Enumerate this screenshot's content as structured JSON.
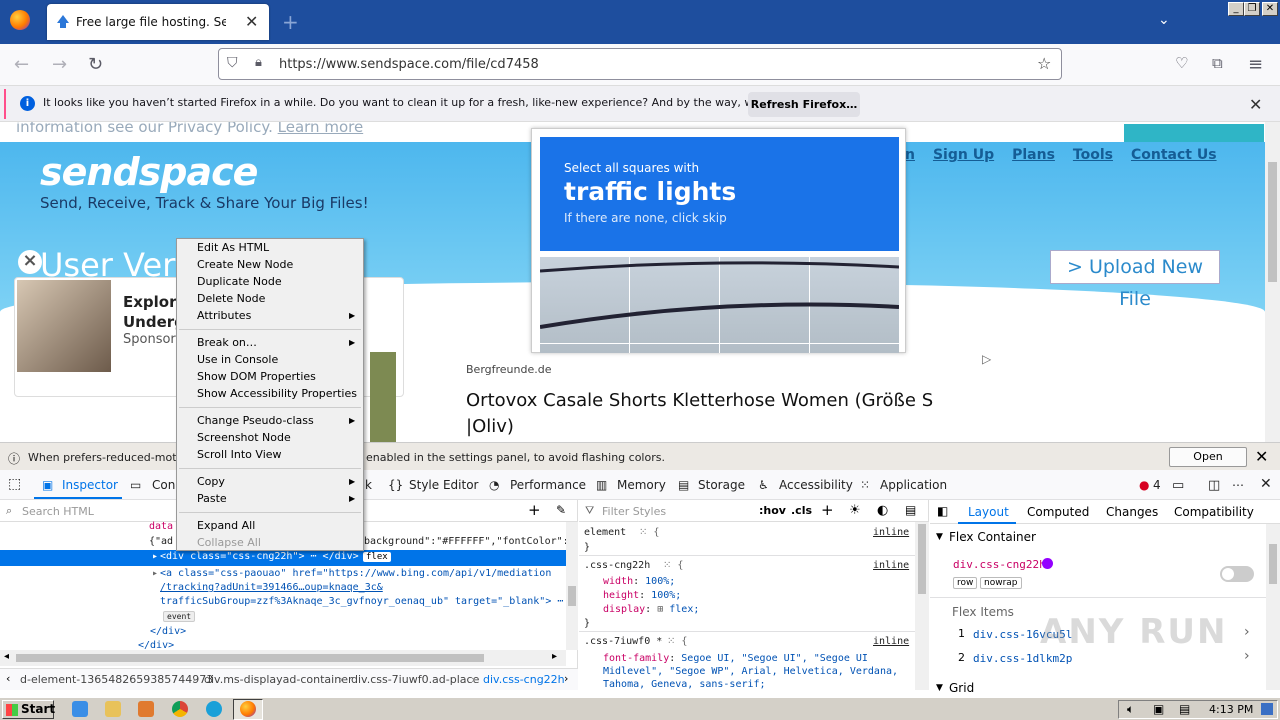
{
  "browser": {
    "tab_title": "Free large file hosting. Send big fil",
    "tab_close": "✕",
    "new_tab": "+",
    "url": "https://www.sendspace.com/file/cd7458",
    "window_buttons": [
      "_",
      "❐",
      "✕"
    ]
  },
  "notification": {
    "message": "It looks like you haven’t started Firefox in a while. Do you want to clean it up for a fresh, like-new experience? And by the way, welcome back!",
    "button": "Refresh Firefox…",
    "close": "✕"
  },
  "page": {
    "privacy_prefix": "information see our Privacy Policy.",
    "privacy_link": "Learn more",
    "logo": "sendspace",
    "tagline": "Send, Receive, Track & Share Your Big Files!",
    "nav": [
      "n",
      "Sign Up",
      "Plans",
      "Tools",
      "Contact Us"
    ],
    "upload_button": "> Upload New File",
    "user_verify": "User Verif",
    "ad_title": "Explori\nUnderg",
    "ad_sponsored": "Sponsor",
    "captcha_line1": "Select all squares with",
    "captcha_line2": "traffic lights",
    "captcha_line3": "If there are none, click skip",
    "ad2_source": "Bergfreunde.de",
    "ad2_title": "Ortovox Casale Shorts Kletterhose Women (Größe S |Oliv)"
  },
  "devtools": {
    "notif_left": "When prefers-reduced-motion",
    "notif_right": "enabled in the settings panel, to avoid flashing colors.",
    "open_settings": "Open Settings",
    "tabs": [
      "Inspector",
      "Cons",
      "k",
      "Style Editor",
      "Performance",
      "Memory",
      "Storage",
      "Accessibility",
      "Application"
    ],
    "error_count": "4",
    "search_placeholder": "Search HTML",
    "html_lines": [
      "data",
      "{\"ad",
      "<div class=\"css-cng22h\"> ⋯ </div>",
      "<a class=\"css-paouao\" href=\"https://www.bing.com/api/v1/mediation",
      "/tracking?adUnit=391466…oup=knaqe_3c&",
      "trafficSubGroup=zzf%3Aknaqe_3c_gvfnoyr_oenaq_ub\" target=\"_blank\"> ⋯",
      "</div>",
      "</div>"
    ],
    "html_fragment": "background\":\"#FFFFFF\",\"fontColor\":",
    "flex_badge": "flex",
    "event_badge": "event",
    "breadcrumbs": [
      "d-element-1365482659385744973",
      "div.ms-displayad-container",
      "div.css-7iuwf0.ad-place",
      "div.css-cng22h"
    ],
    "styles_filter": "Filter Styles",
    "styles_buttons": [
      ":hov",
      ".cls"
    ],
    "rules": [
      {
        "selector": "element",
        "origin": "inline",
        "decls": []
      },
      {
        "selector": ".css-cng22h",
        "origin": "inline",
        "decls": [
          [
            "width",
            "100%;"
          ],
          [
            "height",
            "100%;"
          ],
          [
            "display",
            "flex;"
          ]
        ]
      },
      {
        "selector": ".css-7iuwf0 *",
        "origin": "inline",
        "decls": [
          [
            "font-family",
            "Segoe UI, \"Segoe UI\", \"Segoe UI Midlevel\", \"Segoe WP\", Arial, Helvetica, Verdana, Tahoma, Geneva, sans-serif;"
          ]
        ]
      }
    ],
    "layout_tabs": [
      "Layout",
      "Computed",
      "Changes",
      "Compatibility"
    ],
    "flex_container_label": "Flex Container",
    "flex_container_node": "div.css-cng22h",
    "flex_badges": [
      "row",
      "nowrap"
    ],
    "flex_items_label": "Flex Items",
    "flex_items": [
      {
        "n": "1",
        "node": "div.css-16vcu5l"
      },
      {
        "n": "2",
        "node": "div.css-1dlkm2p"
      }
    ],
    "grid_label": "Grid"
  },
  "context_menu": {
    "items": [
      "Edit As HTML",
      "Create New Node",
      "Duplicate Node",
      "Delete Node",
      "Attributes",
      "Break on…",
      "Use in Console",
      "Show DOM Properties",
      "Show Accessibility Properties",
      "Change Pseudo-class",
      "Screenshot Node",
      "Scroll Into View",
      "Copy",
      "Paste",
      "Expand All",
      "Collapse All"
    ]
  },
  "taskbar": {
    "start": "Start",
    "clock": "4:13 PM"
  },
  "watermark": "ANY RUN"
}
